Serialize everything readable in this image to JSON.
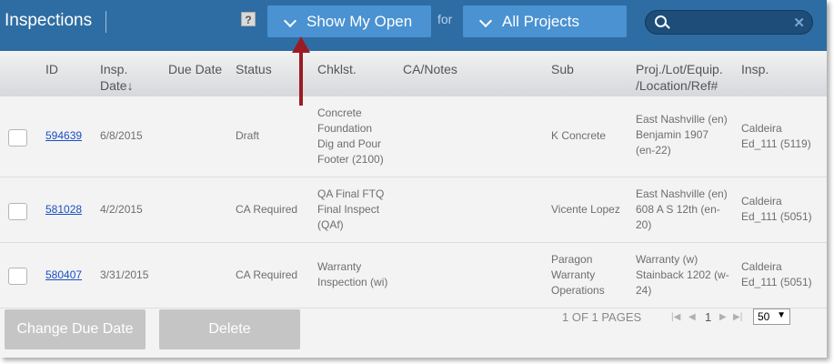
{
  "header": {
    "title": "Inspections",
    "help": "?",
    "filter1": "Show My Open",
    "for": "for",
    "filter2": "All Projects",
    "search": {
      "placeholder": "",
      "clear": "✕"
    }
  },
  "columns": {
    "id": "ID",
    "insp_date_1": "Insp.",
    "insp_date_2": "Date↓",
    "due": "Due Date",
    "status": "Status",
    "chk": "Chklst.",
    "ca": "CA/Notes",
    "sub": "Sub",
    "proj_1": "Proj./Lot/Equip.",
    "proj_2": "/Location/Ref#",
    "insp": "Insp."
  },
  "rows": [
    {
      "id": "594639",
      "date": "6/8/2015",
      "due": "",
      "status": "Draft",
      "chk": [
        "Concrete",
        "Foundation",
        "Dig and Pour",
        "Footer (2100)"
      ],
      "notes": "",
      "sub": [
        "K Concrete"
      ],
      "proj": [
        "East Nashville (en)",
        "Benjamin 1907",
        "(en-22)"
      ],
      "insp": [
        "Caldeira",
        "Ed_111 (5119)"
      ]
    },
    {
      "id": "581028",
      "date": "4/2/2015",
      "due": "",
      "status": "CA Required",
      "chk": [
        "QA Final FTQ",
        "Final Inspect",
        "(QAf)"
      ],
      "notes": "",
      "sub": [
        "Vicente Lopez"
      ],
      "proj": [
        "East Nashville (en)",
        "608 A S 12th (en-",
        "20)"
      ],
      "insp": [
        "Caldeira",
        "Ed_111 (5051)"
      ]
    },
    {
      "id": "580407",
      "date": "3/31/2015",
      "due": "",
      "status": "CA Required",
      "chk": [
        "Warranty",
        "Inspection (wi)"
      ],
      "notes": "",
      "sub": [
        "Paragon",
        "Warranty",
        "Operations"
      ],
      "proj": [
        "Warranty (w)",
        "Stainback 1202 (w-",
        "24)"
      ],
      "insp": [
        "Caldeira",
        "Ed_111 (5051)"
      ]
    }
  ],
  "footer": {
    "change_due": "Change Due Date",
    "delete": "Delete",
    "pages": "1 OF 1 PAGES",
    "first": "|◀",
    "prev": "◀",
    "page": "1",
    "next": "▶",
    "last": "▶|",
    "per_page": "50"
  }
}
